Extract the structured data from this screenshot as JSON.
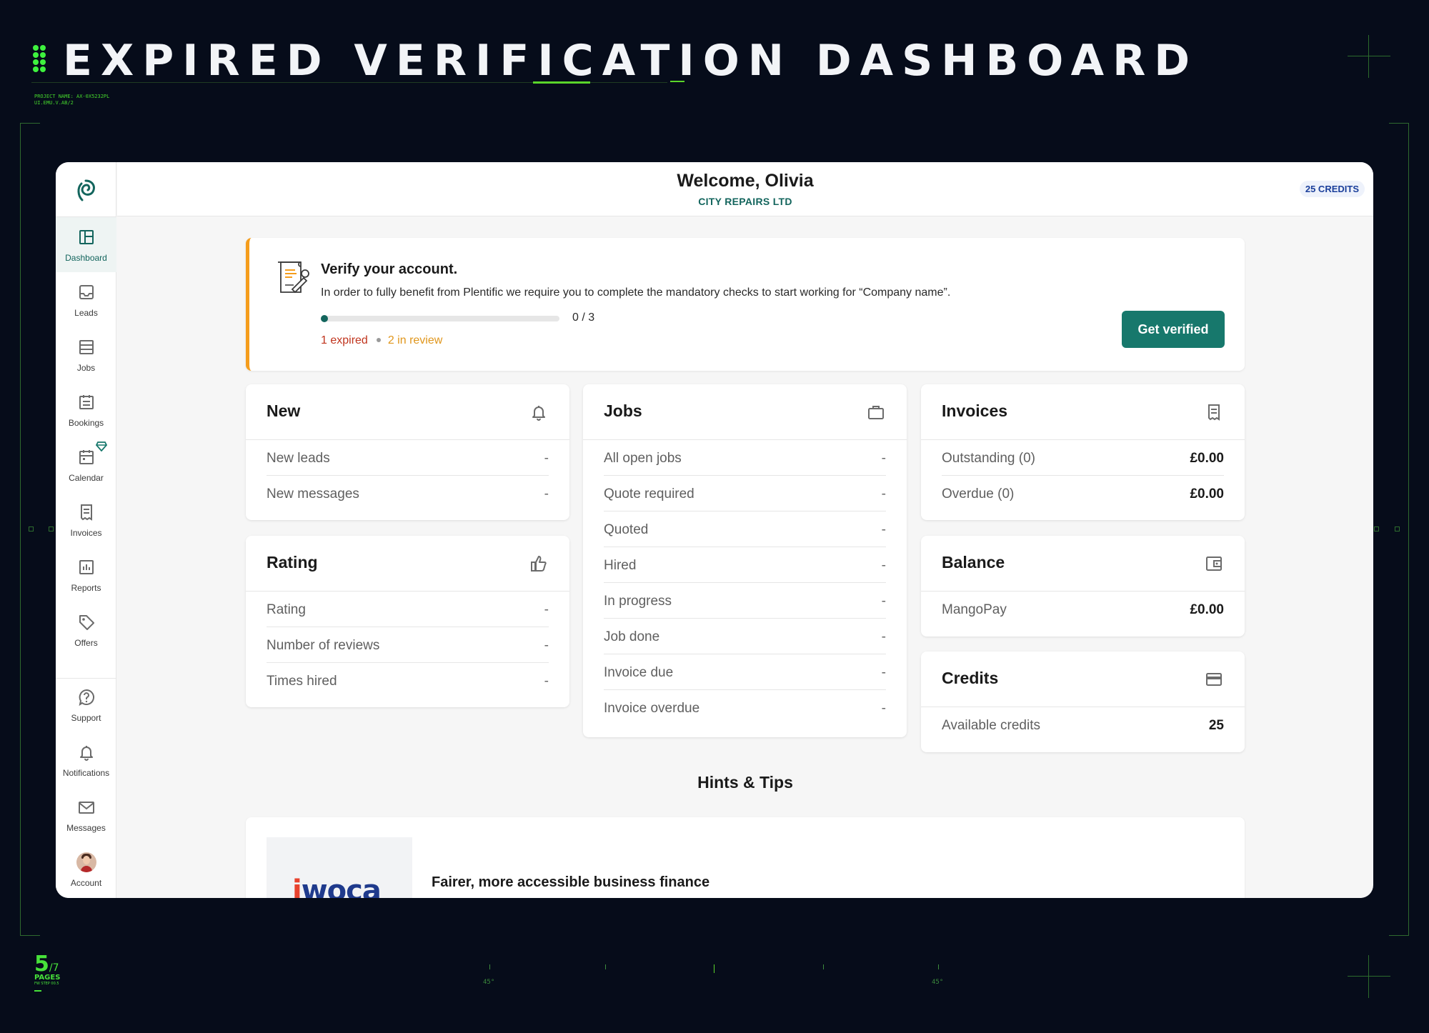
{
  "poster": {
    "title": "EXPIRED VERIFICATION DASHBOARD",
    "project_name": "PROJECT NAME: AX-0X5232PL",
    "project_code": "UI.EMU.V.AB/2",
    "page_current": "5",
    "page_total": "/7",
    "pages_label": "PAGES",
    "pages_sub": "FW STEP 00.5",
    "angle_left": "45°",
    "angle_right": "45°",
    "accent_color": "#5ad52a"
  },
  "header": {
    "welcome": "Welcome, Olivia",
    "company": "CITY REPAIRS LTD",
    "credits": "25 CREDITS"
  },
  "sidebar": {
    "items": [
      {
        "label": "Dashboard",
        "icon": "dashboard-icon",
        "active": true
      },
      {
        "label": "Leads",
        "icon": "inbox-icon"
      },
      {
        "label": "Jobs",
        "icon": "jobs-icon"
      },
      {
        "label": "Bookings",
        "icon": "bookings-icon"
      },
      {
        "label": "Calendar",
        "icon": "calendar-icon"
      },
      {
        "label": "Invoices",
        "icon": "invoice-icon"
      },
      {
        "label": "Reports",
        "icon": "reports-icon"
      },
      {
        "label": "Offers",
        "icon": "tag-icon"
      },
      {
        "label": "Support",
        "icon": "question-icon"
      },
      {
        "label": "Notifications",
        "icon": "bell-icon"
      },
      {
        "label": "Messages",
        "icon": "mail-icon"
      },
      {
        "label": "Account",
        "icon": "avatar"
      }
    ]
  },
  "verify": {
    "title": "Verify your account.",
    "description": "In order to fully benefit from Plentific we require you to complete the mandatory checks to start working for “Company name”.",
    "progress_label": "0 / 3",
    "progress_value": 0,
    "expired_text": "1 expired",
    "review_text": "2 in review",
    "button": "Get verified",
    "accent_color": "#f59d1c",
    "button_color": "#17786c"
  },
  "cards": {
    "new": {
      "title": "New",
      "rows": [
        {
          "label": "New leads",
          "value": "-"
        },
        {
          "label": "New messages",
          "value": "-"
        }
      ]
    },
    "rating": {
      "title": "Rating",
      "rows": [
        {
          "label": "Rating",
          "value": "-"
        },
        {
          "label": "Number of reviews",
          "value": "-"
        },
        {
          "label": "Times hired",
          "value": "-"
        }
      ]
    },
    "jobs": {
      "title": "Jobs",
      "rows": [
        {
          "label": "All open jobs",
          "value": "-"
        },
        {
          "label": "Quote required",
          "value": "-"
        },
        {
          "label": "Quoted",
          "value": "-"
        },
        {
          "label": "Hired",
          "value": "-"
        },
        {
          "label": "In progress",
          "value": "-"
        },
        {
          "label": "Job done",
          "value": "-"
        },
        {
          "label": "Invoice due",
          "value": "-"
        },
        {
          "label": "Invoice overdue",
          "value": "-"
        }
      ]
    },
    "invoices": {
      "title": "Invoices",
      "rows": [
        {
          "label": "Outstanding (0)",
          "value": "£0.00"
        },
        {
          "label": "Overdue (0)",
          "value": "£0.00"
        }
      ]
    },
    "balance": {
      "title": "Balance",
      "rows": [
        {
          "label": "MangoPay",
          "value": "£0.00"
        }
      ]
    },
    "credits": {
      "title": "Credits",
      "rows": [
        {
          "label": "Available credits",
          "value": "25"
        }
      ]
    }
  },
  "hints": {
    "title": "Hints & Tips",
    "card_title": "Fairer, more accessible business finance",
    "brand_prefix": "i",
    "brand_rest": "woca"
  }
}
